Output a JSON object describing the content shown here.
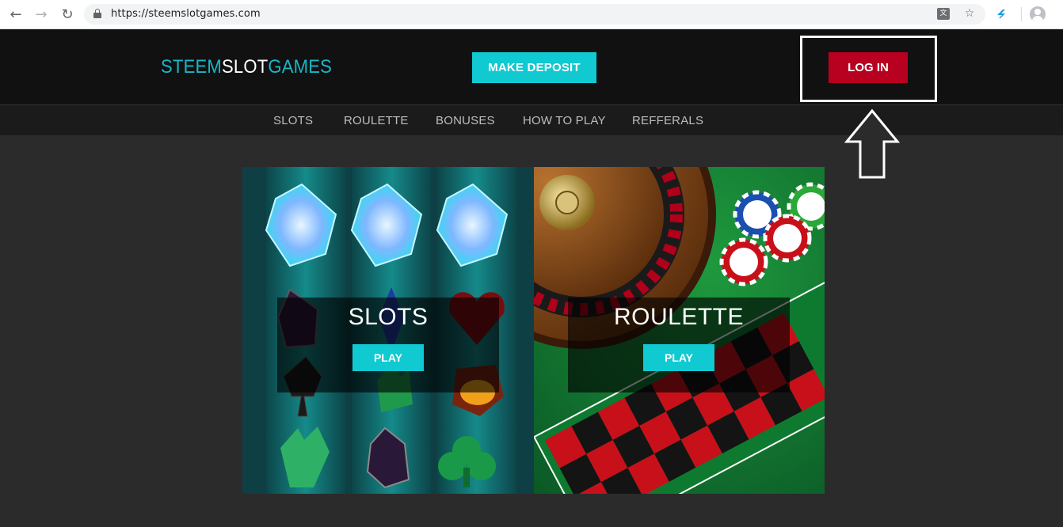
{
  "browser": {
    "url": "https://steemslotgames.com"
  },
  "header": {
    "logo": {
      "part1": "STEEM",
      "part2": "SLOT",
      "part3": "GAMES"
    },
    "deposit_label": "MAKE DEPOSIT",
    "login_label": "LOG IN"
  },
  "nav": {
    "items": [
      {
        "label": "SLOTS"
      },
      {
        "label": "ROULETTE"
      },
      {
        "label": "BONUSES"
      },
      {
        "label": "HOW TO PLAY"
      },
      {
        "label": "REFFERALS"
      }
    ]
  },
  "games": [
    {
      "title": "SLOTS",
      "play_label": "PLAY"
    },
    {
      "title": "ROULETTE",
      "play_label": "PLAY"
    }
  ],
  "colors": {
    "accent": "#10c9d1",
    "login": "#b80020",
    "logo_accent": "#17b8c8"
  }
}
